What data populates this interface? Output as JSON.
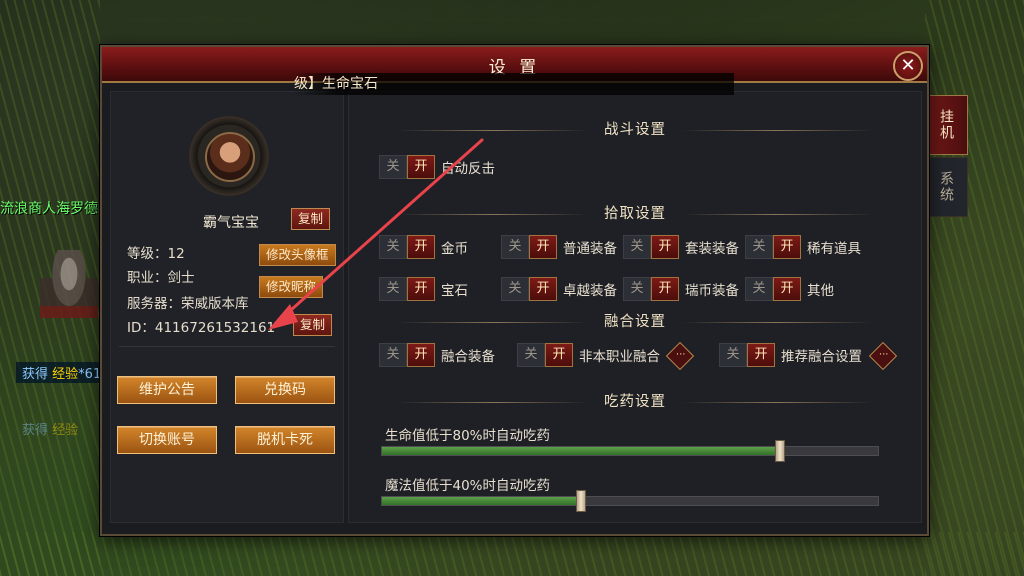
{
  "world": {
    "npc_name": "流浪商人海罗德",
    "msg1": {
      "prefix": "获得",
      "item": "经验",
      "suffix": "*61"
    },
    "msg2": {
      "prefix": "获得",
      "item": "经验",
      "suffix": ""
    }
  },
  "dialog": {
    "title": "设 置",
    "close_label": "✕",
    "ticker": "级】生命宝石"
  },
  "side_tabs": [
    {
      "label": "挂机",
      "active": true
    },
    {
      "label": "系统",
      "active": false
    }
  ],
  "profile": {
    "name": "霸气宝宝",
    "copy_label": "复制",
    "level_line": "等级：12",
    "job_line": "职业：剑士",
    "server_line": "服务器：荣威版本库",
    "id_line": "ID：41167261532161",
    "change_frame_label": "修改头像框",
    "change_nick_label": "修改昵称",
    "copy_id_label": "复制"
  },
  "actions": {
    "notice": "维护公告",
    "redeem": "兑换码",
    "switch_account": "切换账号",
    "unstuck": "脱机卡死"
  },
  "toggle_text": {
    "off": "关",
    "on": "开"
  },
  "sections": {
    "combat": "战斗设置",
    "loot": "拾取设置",
    "fuse": "融合设置",
    "potion": "吃药设置"
  },
  "combat": {
    "auto_counter": "自动反击"
  },
  "loot": [
    "金币",
    "普通装备",
    "套装装备",
    "稀有道具",
    "宝石",
    "卓越装备",
    "瑞币装备",
    "其他"
  ],
  "fuse": {
    "fuse_equip": "融合装备",
    "non_class": "非本职业融合",
    "recommend": "推荐融合设置",
    "more": "···"
  },
  "potion": {
    "hp_label": "生命值低于80%时自动吃药",
    "hp_value": 0.8,
    "mp_label": "魔法值低于40%时自动吃药",
    "mp_value": 0.4
  },
  "colors": {
    "accent_red": "#7d1a16",
    "button_gold": "#d3862a",
    "fill_green": "#5da04a",
    "arrow": "#e8434a"
  }
}
